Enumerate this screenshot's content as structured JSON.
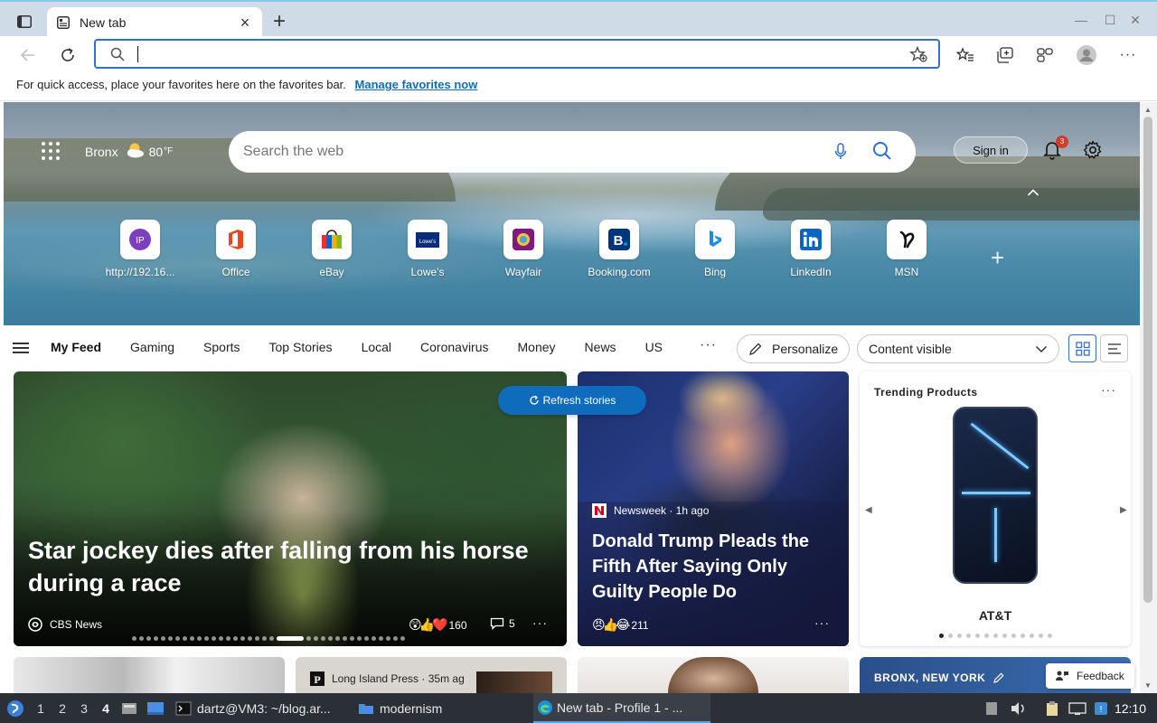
{
  "browser": {
    "tab_title": "New tab",
    "address_value": "",
    "favorites_bar_text": "For quick access, place your favorites here on the favorites bar.",
    "favorites_bar_link": "Manage favorites now"
  },
  "hero": {
    "location": "Bronx",
    "temperature": "80",
    "temperature_unit": "°F",
    "search_placeholder": "Search the web",
    "signin_label": "Sign in",
    "notification_count": "3",
    "tiles": [
      {
        "label": "http://192.16...",
        "icon": "ip-icon"
      },
      {
        "label": "Office",
        "icon": "office-icon"
      },
      {
        "label": "eBay",
        "icon": "ebay-icon"
      },
      {
        "label": "Lowe's",
        "icon": "lowes-icon"
      },
      {
        "label": "Wayfair",
        "icon": "wayfair-icon"
      },
      {
        "label": "Booking.com",
        "icon": "booking-icon"
      },
      {
        "label": "Bing",
        "icon": "bing-icon"
      },
      {
        "label": "LinkedIn",
        "icon": "linkedin-icon"
      },
      {
        "label": "MSN",
        "icon": "msn-icon"
      }
    ]
  },
  "feed_nav": {
    "tabs": [
      "My Feed",
      "Gaming",
      "Sports",
      "Top Stories",
      "Local",
      "Coronavirus",
      "Money",
      "News",
      "US"
    ],
    "personalize_label": "Personalize",
    "content_visibility": "Content visible"
  },
  "refresh_label": "Refresh stories",
  "cards": {
    "main": {
      "headline": "Star jockey dies after falling from his horse during a race",
      "source": "CBS News",
      "reactions": "160",
      "comments": "5"
    },
    "second": {
      "source_line": "Newsweek · 1h ago",
      "headline": "Donald Trump Pleads the Fifth After Saying Only Guilty People Do",
      "reactions": "211"
    },
    "trending": {
      "title": "Trending Products",
      "product": "AT&T"
    },
    "bottom_source": "Long Island Press · 35m ag",
    "location_card": "BRONX, NEW YORK",
    "feedback_label": "Feedback"
  },
  "taskbar": {
    "workspaces": [
      "1",
      "2",
      "3",
      "4"
    ],
    "terminal_label": "dartz@VM3: ~/blog.ar...",
    "folder_label": "modernism",
    "browser_label": "New tab - Profile 1 - ...",
    "clock": "12:10"
  },
  "colors": {
    "accent": "#0f6cbd",
    "notification": "#d63a2f"
  }
}
